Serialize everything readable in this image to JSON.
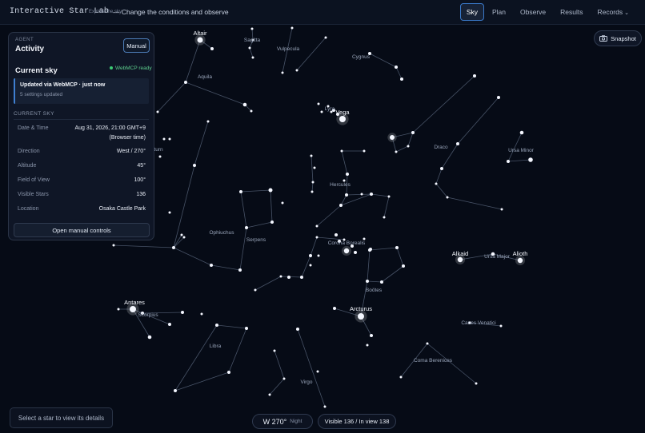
{
  "app": {
    "brand": "Interactive Star Lab",
    "brand_sub": "Explore the sky",
    "tagline": "— Change the conditions and observe"
  },
  "nav": {
    "tabs": [
      "Sky",
      "Plan",
      "Observe",
      "Results",
      "Records"
    ],
    "active": "Sky"
  },
  "panel": {
    "agent_label": "AGENT",
    "title": "Activity",
    "manual_button": "Manual",
    "current_sky_title": "Current sky",
    "status": "WebMCP ready",
    "update_title": "Updated via WebMCP · just now",
    "update_sub": "5 settings updated",
    "section_header": "CURRENT SKY",
    "rows": [
      {
        "label": "Date & Time",
        "value": "Aug 31, 2026, 21:00 GMT+9",
        "value2": "(Browser time)"
      },
      {
        "label": "Direction",
        "value": "West / 270°"
      },
      {
        "label": "Altitude",
        "value": "45°"
      },
      {
        "label": "Field of View",
        "value": "100°"
      },
      {
        "label": "Visible Stars",
        "value": "136"
      },
      {
        "label": "Location",
        "value": "Osaka Castle Park"
      }
    ],
    "open_button": "Open manual controls"
  },
  "snapshot": {
    "label": "Snapshot",
    "icon": "camera-icon"
  },
  "footer": {
    "select_hint": "Select a star to view its details",
    "direction": "W 270°",
    "direction_sub": "Night",
    "visible": "Visible 136 / In view 138"
  },
  "colors": {
    "background": "#060b16",
    "accent": "#3a78c8",
    "status_green": "#3ccb74",
    "constellation_line": "#5d6b82"
  },
  "sky": {
    "star_labels": [
      "Altair",
      "Vega",
      "Arcturus",
      "Antares",
      "Alkaid",
      "Alioth"
    ],
    "constellation_labels": [
      "Sagitta",
      "Vulpecula",
      "Cygnus",
      "Aquila",
      "Lyra",
      "Draco",
      "Ursa Minor",
      "Hercules",
      "Ophiuchus",
      "Serpens",
      "Corona Borealis",
      "Ursa Major",
      "Boötes",
      "Scorpius",
      "Libra",
      "Canes Venatici",
      "Coma Berenices",
      "Virgo",
      "turn"
    ]
  }
}
